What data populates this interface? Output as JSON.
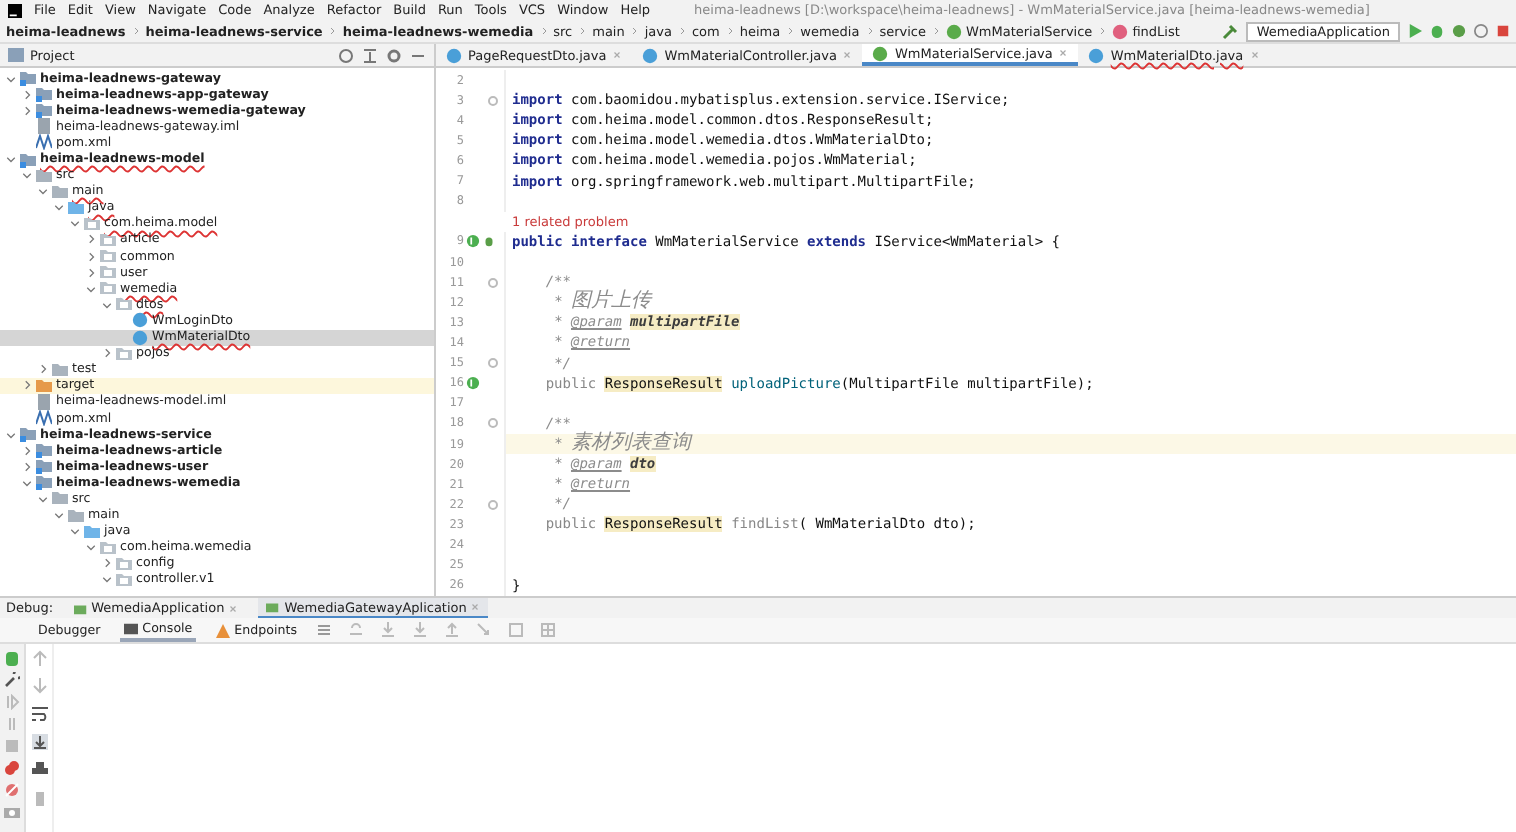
{
  "menu": {
    "items": [
      "File",
      "Edit",
      "View",
      "Navigate",
      "Code",
      "Analyze",
      "Refactor",
      "Build",
      "Run",
      "Tools",
      "VCS",
      "Window",
      "Help"
    ],
    "title": "heima-leadnews [D:\\workspace\\heima-leadnews] - WmMaterialService.java [heima-leadnews-wemedia]"
  },
  "breadcrumbs": [
    {
      "label": "heima-leadnews",
      "kind": "module"
    },
    {
      "label": "heima-leadnews-service",
      "kind": "module"
    },
    {
      "label": "heima-leadnews-wemedia",
      "kind": "module"
    },
    {
      "label": "src",
      "kind": "folder"
    },
    {
      "label": "main",
      "kind": "folder"
    },
    {
      "label": "java",
      "kind": "folder"
    },
    {
      "label": "com",
      "kind": "folder"
    },
    {
      "label": "heima",
      "kind": "folder"
    },
    {
      "label": "wemedia",
      "kind": "folder"
    },
    {
      "label": "service",
      "kind": "folder"
    },
    {
      "label": "WmMaterialService",
      "kind": "interface"
    },
    {
      "label": "findList",
      "kind": "method"
    }
  ],
  "run_config": "WemediaApplication",
  "project_panel": {
    "title": "Project",
    "tree": [
      {
        "label": "heima-leadnews-gateway",
        "kind": "module",
        "expanded": true,
        "error": false,
        "selected": false,
        "children": [
          {
            "label": "heima-leadnews-app-gateway",
            "kind": "module",
            "expanded": false,
            "error": false,
            "selected": false
          },
          {
            "label": "heima-leadnews-wemedia-gateway",
            "kind": "module",
            "expanded": false,
            "error": false,
            "selected": false
          },
          {
            "label": "heima-leadnews-gateway.iml",
            "kind": "iml",
            "error": false,
            "selected": false
          },
          {
            "label": "pom.xml",
            "kind": "pom",
            "error": false,
            "selected": false
          }
        ]
      },
      {
        "label": "heima-leadnews-model",
        "kind": "module",
        "expanded": true,
        "error": true,
        "selected": false,
        "children": [
          {
            "label": "src",
            "kind": "folder",
            "expanded": true,
            "error": false,
            "selected": false,
            "children": [
              {
                "label": "main",
                "kind": "folder",
                "expanded": true,
                "error": true,
                "selected": false,
                "children": [
                  {
                    "label": "java",
                    "kind": "source",
                    "expanded": true,
                    "error": true,
                    "selected": false,
                    "children": [
                      {
                        "label": "com.heima.model",
                        "kind": "package",
                        "expanded": true,
                        "error": true,
                        "selected": false,
                        "children": [
                          {
                            "label": "article",
                            "kind": "package",
                            "expanded": false,
                            "error": false,
                            "selected": false
                          },
                          {
                            "label": "common",
                            "kind": "package",
                            "expanded": false,
                            "error": false,
                            "selected": false
                          },
                          {
                            "label": "user",
                            "kind": "package",
                            "expanded": false,
                            "error": false,
                            "selected": false
                          },
                          {
                            "label": "wemedia",
                            "kind": "package",
                            "expanded": true,
                            "error": true,
                            "selected": false,
                            "children": [
                              {
                                "label": "dtos",
                                "kind": "package",
                                "expanded": true,
                                "error": true,
                                "selected": false,
                                "children": [
                                  {
                                    "label": "WmLoginDto",
                                    "kind": "class",
                                    "error": false,
                                    "selected": false
                                  },
                                  {
                                    "label": "WmMaterialDto",
                                    "kind": "class",
                                    "error": true,
                                    "selected": true
                                  }
                                ]
                              },
                              {
                                "label": "pojos",
                                "kind": "package",
                                "expanded": false,
                                "error": false,
                                "selected": false
                              }
                            ]
                          }
                        ]
                      }
                    ]
                  }
                ]
              },
              {
                "label": "test",
                "kind": "folder",
                "expanded": false,
                "error": false,
                "selected": false
              }
            ]
          },
          {
            "label": "target",
            "kind": "target",
            "expanded": false,
            "error": false,
            "selected": false
          },
          {
            "label": "heima-leadnews-model.iml",
            "kind": "iml",
            "error": false,
            "selected": false
          },
          {
            "label": "pom.xml",
            "kind": "pom",
            "error": false,
            "selected": false
          }
        ]
      },
      {
        "label": "heima-leadnews-service",
        "kind": "module",
        "expanded": true,
        "error": false,
        "selected": false,
        "children": [
          {
            "label": "heima-leadnews-article",
            "kind": "module",
            "expanded": false,
            "error": false,
            "selected": false
          },
          {
            "label": "heima-leadnews-user",
            "kind": "module",
            "expanded": false,
            "error": false,
            "selected": false
          },
          {
            "label": "heima-leadnews-wemedia",
            "kind": "module",
            "expanded": true,
            "error": false,
            "selected": false,
            "children": [
              {
                "label": "src",
                "kind": "folder",
                "expanded": true,
                "error": false,
                "selected": false,
                "children": [
                  {
                    "label": "main",
                    "kind": "folder",
                    "expanded": true,
                    "error": false,
                    "selected": false,
                    "children": [
                      {
                        "label": "java",
                        "kind": "source",
                        "expanded": true,
                        "error": false,
                        "selected": false,
                        "children": [
                          {
                            "label": "com.heima.wemedia",
                            "kind": "package",
                            "expanded": true,
                            "error": false,
                            "selected": false,
                            "children": [
                              {
                                "label": "config",
                                "kind": "package",
                                "expanded": false,
                                "error": false,
                                "selected": false
                              },
                              {
                                "label": "controller.v1",
                                "kind": "package",
                                "expanded": true,
                                "error": false,
                                "selected": false
                              }
                            ]
                          }
                        ]
                      }
                    ]
                  }
                ]
              }
            ]
          }
        ]
      }
    ]
  },
  "editor_tabs": [
    {
      "label": "PageRequestDto.java",
      "kind": "class",
      "selected": false,
      "error": false
    },
    {
      "label": "WmMaterialController.java",
      "kind": "class",
      "selected": false,
      "error": false
    },
    {
      "label": "WmMaterialService.java",
      "kind": "interface",
      "selected": true,
      "error": false
    },
    {
      "label": "WmMaterialDto.java",
      "kind": "class",
      "selected": false,
      "error": true
    }
  ],
  "editor": {
    "lines": [
      {
        "number": "2",
        "current": false
      },
      {
        "number": "3",
        "kind": "top",
        "current": false,
        "fold": true,
        "tokens": [
          {
            "kind": "kw",
            "text": "import"
          },
          {
            "kind": "plain",
            "text": " com.baomidou.mybatisplus.extension.service.IService;"
          }
        ]
      },
      {
        "number": "4",
        "kind": "top",
        "current": false,
        "tokens": [
          {
            "kind": "kw",
            "text": "import"
          },
          {
            "kind": "plain",
            "text": " com.heima.model.common.dtos.ResponseResult;"
          }
        ]
      },
      {
        "number": "5",
        "kind": "top",
        "current": false,
        "tokens": [
          {
            "kind": "kw",
            "text": "import"
          },
          {
            "kind": "plain",
            "text": " com.heima.model.wemedia.dtos.WmMaterialDto;"
          }
        ]
      },
      {
        "number": "6",
        "kind": "top",
        "current": false,
        "tokens": [
          {
            "kind": "kw",
            "text": "import"
          },
          {
            "kind": "plain",
            "text": " com.heima.model.wemedia.pojos.WmMaterial;"
          }
        ]
      },
      {
        "number": "7",
        "kind": "top",
        "current": false,
        "tokens": [
          {
            "kind": "kw",
            "text": "import"
          },
          {
            "kind": "plain",
            "text": " org.springframework.web.multipart.MultipartFile;"
          }
        ]
      },
      {
        "number": "8",
        "current": false
      },
      {
        "number": "9",
        "kind": "top",
        "current": false,
        "hint": "1 related problem",
        "markers": [
          {
            "kind": "implemented"
          },
          {
            "kind": "debug"
          }
        ],
        "tokens": [
          {
            "kind": "kw",
            "text": "public interface"
          },
          {
            "kind": "plain",
            "text": " WmMaterialService "
          },
          {
            "kind": "kw",
            "text": "extends"
          },
          {
            "kind": "plain",
            "text": " IService<WmMaterial> {"
          }
        ]
      },
      {
        "number": "10",
        "current": false
      },
      {
        "number": "11",
        "kind": "member",
        "current": false,
        "fold": true,
        "tokens": [
          {
            "kind": "doc",
            "text": "/**"
          }
        ]
      },
      {
        "number": "12",
        "kind": "doc",
        "current": false,
        "tokens": [
          {
            "kind": "doc",
            "text": "* "
          },
          {
            "kind": "cjk",
            "text": "图片上传"
          }
        ]
      },
      {
        "number": "13",
        "kind": "doc",
        "current": false,
        "tokens": [
          {
            "kind": "doc",
            "text": "* "
          },
          {
            "kind": "doctag",
            "text": "@param"
          },
          {
            "kind": "docparam",
            "text": "multipartFile"
          }
        ]
      },
      {
        "number": "14",
        "kind": "doc",
        "current": false,
        "tokens": [
          {
            "kind": "doc",
            "text": "* "
          },
          {
            "kind": "doctag",
            "text": "@return"
          }
        ]
      },
      {
        "number": "15",
        "kind": "doc",
        "current": false,
        "fold": true,
        "tokens": [
          {
            "kind": "doc",
            "text": "*/"
          }
        ]
      },
      {
        "number": "16",
        "kind": "member",
        "current": false,
        "markers": [
          {
            "kind": "implemented"
          }
        ],
        "tokens": [
          {
            "kind": "muted",
            "text": "public "
          },
          {
            "kind": "typehl",
            "text": "ResponseResult"
          },
          {
            "kind": "method",
            "text": " uploadPicture"
          },
          {
            "kind": "plain",
            "text": "(MultipartFile multipartFile);"
          }
        ]
      },
      {
        "number": "17",
        "current": false
      },
      {
        "number": "18",
        "kind": "member",
        "current": false,
        "fold": true,
        "tokens": [
          {
            "kind": "doc",
            "text": "/**"
          }
        ]
      },
      {
        "number": "19",
        "kind": "doc",
        "current": true,
        "tokens": [
          {
            "kind": "doc",
            "text": "* "
          },
          {
            "kind": "cjk",
            "text": "素材列表查询"
          }
        ]
      },
      {
        "number": "20",
        "kind": "doc",
        "current": false,
        "tokens": [
          {
            "kind": "doc",
            "text": "* "
          },
          {
            "kind": "doctag",
            "text": "@param"
          },
          {
            "kind": "docparam",
            "text": "dto"
          }
        ]
      },
      {
        "number": "21",
        "kind": "doc",
        "current": false,
        "tokens": [
          {
            "kind": "doc",
            "text": "* "
          },
          {
            "kind": "doctag",
            "text": "@return"
          }
        ]
      },
      {
        "number": "22",
        "kind": "doc",
        "current": false,
        "fold": true,
        "tokens": [
          {
            "kind": "doc",
            "text": "*/"
          }
        ]
      },
      {
        "number": "23",
        "kind": "member",
        "current": false,
        "tokens": [
          {
            "kind": "muted",
            "text": "public "
          },
          {
            "kind": "typehl",
            "text": "ResponseResult"
          },
          {
            "kind": "muted",
            "text": " findList"
          },
          {
            "kind": "plain",
            "text": "( WmMaterialDto dto);"
          }
        ]
      },
      {
        "number": "24",
        "current": false
      },
      {
        "number": "25",
        "current": false
      },
      {
        "number": "26",
        "kind": "top",
        "current": false,
        "tokens": [
          {
            "kind": "plain",
            "text": "}"
          }
        ]
      }
    ]
  },
  "debug": {
    "label": "Debug:",
    "sessions": [
      {
        "label": "WemediaApplication",
        "selected": false
      },
      {
        "label": "WemediaGatewayAplication",
        "selected": true
      }
    ],
    "tabs": [
      {
        "label": "Debugger",
        "kind": "plain",
        "selected": false
      },
      {
        "label": "Console",
        "kind": "console",
        "selected": true
      },
      {
        "label": "Endpoints",
        "kind": "endpoints",
        "selected": false
      }
    ]
  }
}
